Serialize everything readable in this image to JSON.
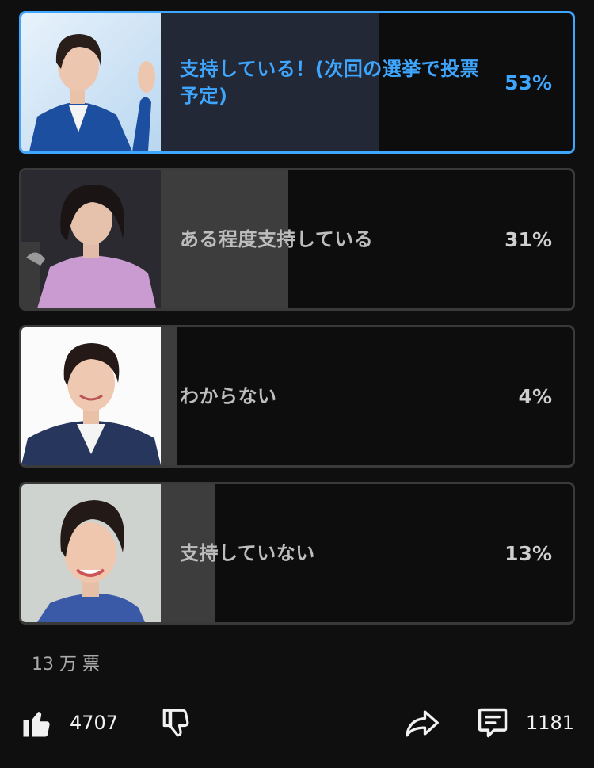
{
  "poll": {
    "options": [
      {
        "label": "支持している！(次回の選挙で投票予定)",
        "percent_text": "53%",
        "percent": 53,
        "selected": true
      },
      {
        "label": "ある程度支持している",
        "percent_text": "31%",
        "percent": 31,
        "selected": false
      },
      {
        "label": "わからない",
        "percent_text": "4%",
        "percent": 4,
        "selected": false
      },
      {
        "label": "支持していない",
        "percent_text": "13%",
        "percent": 13,
        "selected": false
      }
    ],
    "vote_count": "13 万 票"
  },
  "actions": {
    "like_count": "4707",
    "comment_count": "1181",
    "icons": [
      "thumbs-up-icon",
      "thumbs-down-icon",
      "share-icon",
      "comment-icon"
    ]
  },
  "colors": {
    "accent": "#3ea6ff",
    "background": "#0f0f0f",
    "bar_fill": "#3d3d3d",
    "selected_fill": "#222836"
  }
}
